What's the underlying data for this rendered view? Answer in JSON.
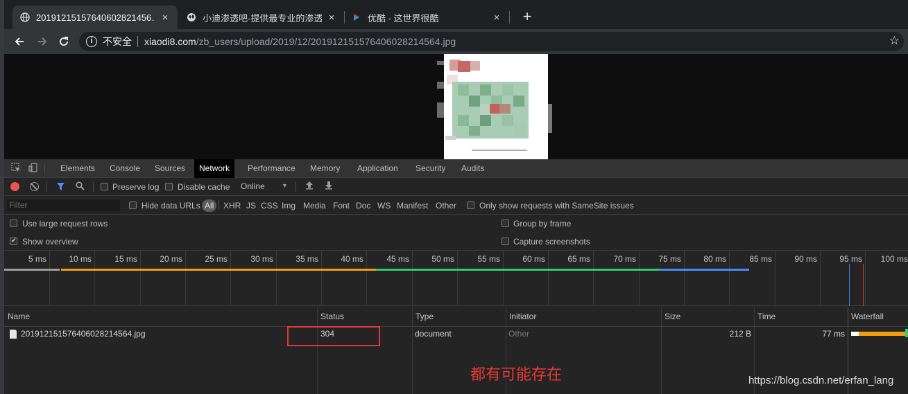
{
  "browser": {
    "tabs": [
      {
        "title": "20191215157640602821456…",
        "favicon": "globe-icon",
        "active": true
      },
      {
        "title": "小迪渗透吧-提供最专业的渗透测",
        "favicon": "globe-icon",
        "active": false
      },
      {
        "title": "优酷 - 这世界很酷",
        "favicon": "youku-icon",
        "active": false
      }
    ],
    "tab_close_glyph": "×",
    "new_tab_glyph": "+",
    "omnibox": {
      "security_label": "不安全",
      "host": "xiaodi8.com",
      "path": "/zb_users/upload/2019/12/201912151576406028214564.jpg"
    }
  },
  "devtools": {
    "panels": [
      "Elements",
      "Console",
      "Sources",
      "Network",
      "Performance",
      "Memory",
      "Application",
      "Security",
      "Audits"
    ],
    "selected_panel": "Network",
    "toolbar": {
      "preserve_log": "Preserve log",
      "disable_cache": "Disable cache",
      "throttling": "Online"
    },
    "filter": {
      "placeholder": "Filter",
      "hide_data_urls": "Hide data URLs",
      "types": [
        "All",
        "XHR",
        "JS",
        "CSS",
        "Img",
        "Media",
        "Font",
        "Doc",
        "WS",
        "Manifest",
        "Other"
      ],
      "samesite": "Only show requests with SameSite issues"
    },
    "options": {
      "large_rows": "Use large request rows",
      "show_overview": "Show overview",
      "group_by_frame": "Group by frame",
      "capture_screenshots": "Capture screenshots"
    },
    "timeline_ticks": [
      "5 ms",
      "10 ms",
      "15 ms",
      "20 ms",
      "25 ms",
      "30 ms",
      "35 ms",
      "40 ms",
      "45 ms",
      "50 ms",
      "55 ms",
      "60 ms",
      "65 ms",
      "70 ms",
      "75 ms",
      "80 ms",
      "85 ms",
      "90 ms",
      "95 ms",
      "100 ms"
    ],
    "table": {
      "columns": [
        "Name",
        "Status",
        "Type",
        "Initiator",
        "Size",
        "Time",
        "Waterfall"
      ],
      "rows": [
        {
          "name": "201912151576406028214564.jpg",
          "status": "304",
          "type": "document",
          "initiator": "Other",
          "size": "212 B",
          "time": "77 ms"
        }
      ]
    }
  },
  "annotation": {
    "text": "都有可能存在",
    "color": "#e53935"
  },
  "watermark": "https://blog.csdn.net/erfan_lang"
}
